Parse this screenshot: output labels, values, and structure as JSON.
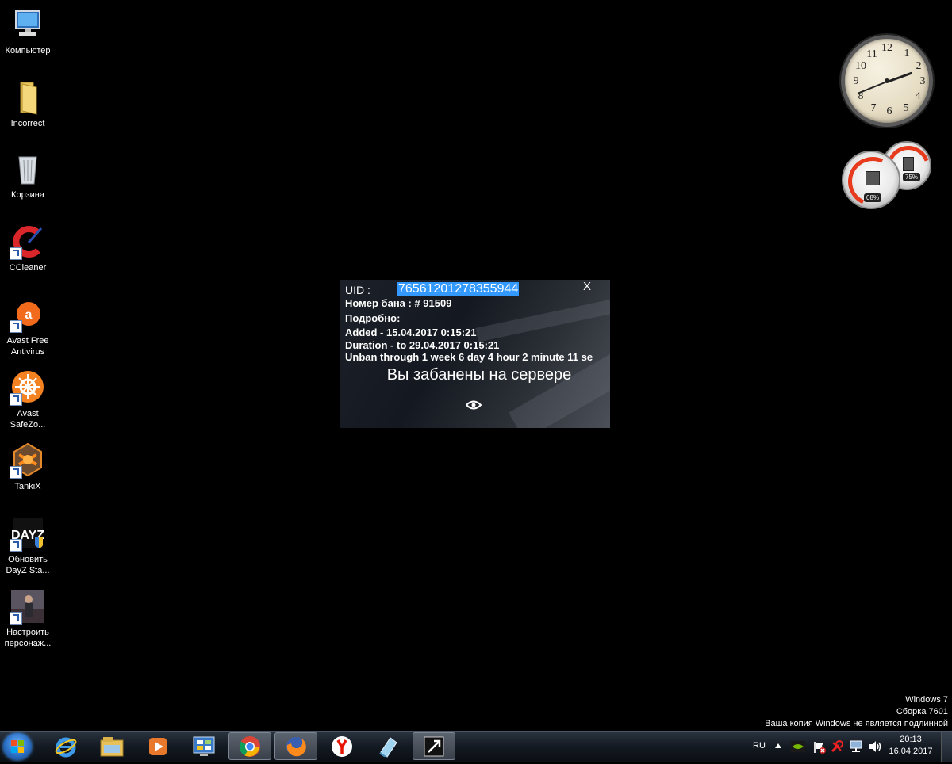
{
  "desktop": {
    "icons": [
      {
        "label_1": "Компьютер",
        "label_2": "",
        "icon": "computer-icon"
      },
      {
        "label_1": "Incorrect",
        "label_2": "",
        "icon": "folder-icon"
      },
      {
        "label_1": "Корзина",
        "label_2": "",
        "icon": "recycle-bin-icon"
      },
      {
        "label_1": "CCleaner",
        "label_2": "",
        "icon": "ccleaner-icon"
      },
      {
        "label_1": "Avast Free",
        "label_2": "Antivirus",
        "icon": "avast-icon"
      },
      {
        "label_1": "Avast",
        "label_2": "SafeZo...",
        "icon": "avast-safezone-icon"
      },
      {
        "label_1": "TankiX",
        "label_2": "",
        "icon": "tankix-icon"
      },
      {
        "label_1": "Обновить",
        "label_2": "DayZ Sta...",
        "icon": "dayz-icon"
      },
      {
        "label_1": "Настроить",
        "label_2": "персонаж...",
        "icon": "character-icon"
      }
    ]
  },
  "gadgets": {
    "clock": {
      "numbers": [
        "12",
        "1",
        "2",
        "3",
        "4",
        "5",
        "6",
        "7",
        "8",
        "9",
        "10",
        "11"
      ]
    },
    "cpu_meter": {
      "cpu_percent": "08%",
      "ram_percent": "75%"
    }
  },
  "ban_dialog": {
    "uid_label": "UID :",
    "uid_value": "76561201278355944",
    "close_label": "X",
    "ban_number": "Номер бана :  # 91509",
    "details_label": "Подробно:",
    "added": "Added - 15.04.2017 0:15:21",
    "duration": "Duration -  to 29.04.2017 0:15:21",
    "unban": "Unban through 1 week  6 day  4 hour  2 minute  11 se",
    "title": "Вы забанены на сервере"
  },
  "watermark": {
    "line1": "Windows 7",
    "line2": "Сборка 7601",
    "line3": "Ваша копия Windows не является подлинной"
  },
  "taskbar": {
    "pinned": [
      "internet-explorer-icon",
      "file-explorer-icon",
      "media-player-icon",
      "control-panel-icon",
      "chrome-icon",
      "firefox-icon",
      "yandex-browser-icon",
      "tankix-launcher-icon",
      "app-window-icon"
    ],
    "tray": {
      "language": "RU",
      "time": "20:13",
      "date": "16.04.2017"
    }
  },
  "colors": {
    "selection": "#3399ff",
    "desktop_bg": "#000000"
  }
}
